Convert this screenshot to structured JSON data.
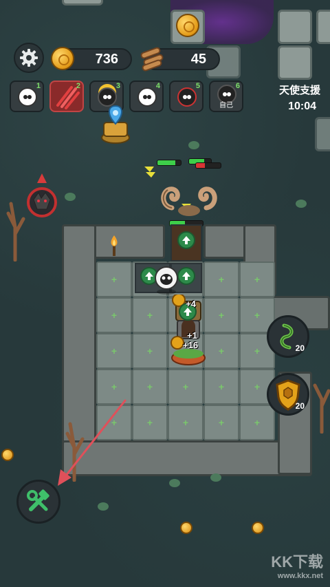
{
  "settings_icon": "gear-icon",
  "resources": {
    "gold": "736",
    "wood": "45"
  },
  "units": [
    {
      "slot": "1",
      "icon": "white-sheep-icon",
      "label": ""
    },
    {
      "slot": "2",
      "icon": "claw-slash-icon",
      "label": ""
    },
    {
      "slot": "3",
      "icon": "blond-sheep-icon",
      "label": ""
    },
    {
      "slot": "4",
      "icon": "white-sheep-icon",
      "label": ""
    },
    {
      "slot": "5",
      "icon": "black-sheep-icon",
      "label": ""
    },
    {
      "slot": "6",
      "icon": "black-sheep-icon",
      "label": "自己"
    }
  ],
  "support": {
    "title": "天使支援",
    "timer": "10:04"
  },
  "floating": {
    "plus_four": "+4",
    "plus_one": "+1",
    "plus_sixteen": "+16"
  },
  "side_buttons": {
    "vine": "20",
    "shield": "20"
  },
  "tools_icon": "hammer-wrench-icon",
  "watermark": {
    "main": "KK下载",
    "sub": "www.kkx.net"
  },
  "colors": {
    "accent_green": "#2d8a4a",
    "active_slot": "#8a2a2a",
    "gold": "#e39a17",
    "arrow": "#e0505a"
  }
}
